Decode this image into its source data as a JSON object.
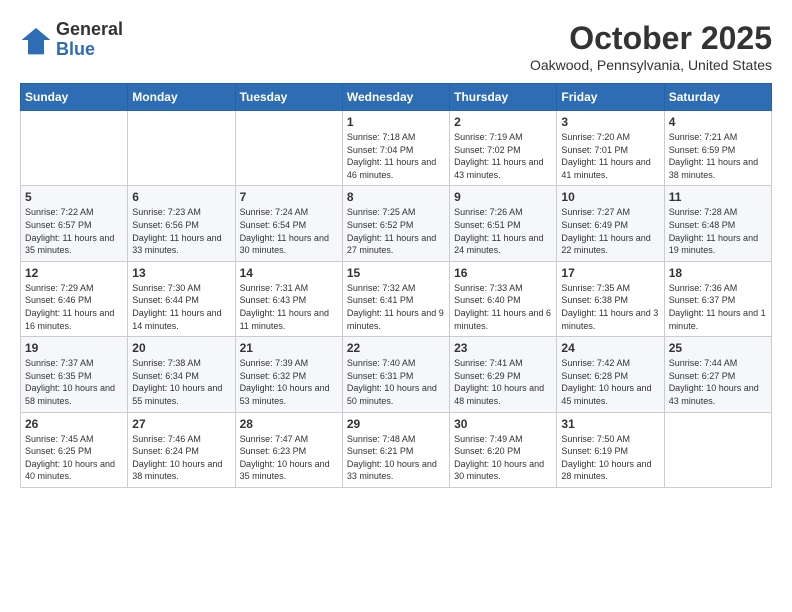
{
  "logo": {
    "general": "General",
    "blue": "Blue"
  },
  "title": "October 2025",
  "location": "Oakwood, Pennsylvania, United States",
  "days_of_week": [
    "Sunday",
    "Monday",
    "Tuesday",
    "Wednesday",
    "Thursday",
    "Friday",
    "Saturday"
  ],
  "weeks": [
    [
      {
        "day": "",
        "sunrise": "",
        "sunset": "",
        "daylight": ""
      },
      {
        "day": "",
        "sunrise": "",
        "sunset": "",
        "daylight": ""
      },
      {
        "day": "",
        "sunrise": "",
        "sunset": "",
        "daylight": ""
      },
      {
        "day": "1",
        "sunrise": "Sunrise: 7:18 AM",
        "sunset": "Sunset: 7:04 PM",
        "daylight": "Daylight: 11 hours and 46 minutes."
      },
      {
        "day": "2",
        "sunrise": "Sunrise: 7:19 AM",
        "sunset": "Sunset: 7:02 PM",
        "daylight": "Daylight: 11 hours and 43 minutes."
      },
      {
        "day": "3",
        "sunrise": "Sunrise: 7:20 AM",
        "sunset": "Sunset: 7:01 PM",
        "daylight": "Daylight: 11 hours and 41 minutes."
      },
      {
        "day": "4",
        "sunrise": "Sunrise: 7:21 AM",
        "sunset": "Sunset: 6:59 PM",
        "daylight": "Daylight: 11 hours and 38 minutes."
      }
    ],
    [
      {
        "day": "5",
        "sunrise": "Sunrise: 7:22 AM",
        "sunset": "Sunset: 6:57 PM",
        "daylight": "Daylight: 11 hours and 35 minutes."
      },
      {
        "day": "6",
        "sunrise": "Sunrise: 7:23 AM",
        "sunset": "Sunset: 6:56 PM",
        "daylight": "Daylight: 11 hours and 33 minutes."
      },
      {
        "day": "7",
        "sunrise": "Sunrise: 7:24 AM",
        "sunset": "Sunset: 6:54 PM",
        "daylight": "Daylight: 11 hours and 30 minutes."
      },
      {
        "day": "8",
        "sunrise": "Sunrise: 7:25 AM",
        "sunset": "Sunset: 6:52 PM",
        "daylight": "Daylight: 11 hours and 27 minutes."
      },
      {
        "day": "9",
        "sunrise": "Sunrise: 7:26 AM",
        "sunset": "Sunset: 6:51 PM",
        "daylight": "Daylight: 11 hours and 24 minutes."
      },
      {
        "day": "10",
        "sunrise": "Sunrise: 7:27 AM",
        "sunset": "Sunset: 6:49 PM",
        "daylight": "Daylight: 11 hours and 22 minutes."
      },
      {
        "day": "11",
        "sunrise": "Sunrise: 7:28 AM",
        "sunset": "Sunset: 6:48 PM",
        "daylight": "Daylight: 11 hours and 19 minutes."
      }
    ],
    [
      {
        "day": "12",
        "sunrise": "Sunrise: 7:29 AM",
        "sunset": "Sunset: 6:46 PM",
        "daylight": "Daylight: 11 hours and 16 minutes."
      },
      {
        "day": "13",
        "sunrise": "Sunrise: 7:30 AM",
        "sunset": "Sunset: 6:44 PM",
        "daylight": "Daylight: 11 hours and 14 minutes."
      },
      {
        "day": "14",
        "sunrise": "Sunrise: 7:31 AM",
        "sunset": "Sunset: 6:43 PM",
        "daylight": "Daylight: 11 hours and 11 minutes."
      },
      {
        "day": "15",
        "sunrise": "Sunrise: 7:32 AM",
        "sunset": "Sunset: 6:41 PM",
        "daylight": "Daylight: 11 hours and 9 minutes."
      },
      {
        "day": "16",
        "sunrise": "Sunrise: 7:33 AM",
        "sunset": "Sunset: 6:40 PM",
        "daylight": "Daylight: 11 hours and 6 minutes."
      },
      {
        "day": "17",
        "sunrise": "Sunrise: 7:35 AM",
        "sunset": "Sunset: 6:38 PM",
        "daylight": "Daylight: 11 hours and 3 minutes."
      },
      {
        "day": "18",
        "sunrise": "Sunrise: 7:36 AM",
        "sunset": "Sunset: 6:37 PM",
        "daylight": "Daylight: 11 hours and 1 minute."
      }
    ],
    [
      {
        "day": "19",
        "sunrise": "Sunrise: 7:37 AM",
        "sunset": "Sunset: 6:35 PM",
        "daylight": "Daylight: 10 hours and 58 minutes."
      },
      {
        "day": "20",
        "sunrise": "Sunrise: 7:38 AM",
        "sunset": "Sunset: 6:34 PM",
        "daylight": "Daylight: 10 hours and 55 minutes."
      },
      {
        "day": "21",
        "sunrise": "Sunrise: 7:39 AM",
        "sunset": "Sunset: 6:32 PM",
        "daylight": "Daylight: 10 hours and 53 minutes."
      },
      {
        "day": "22",
        "sunrise": "Sunrise: 7:40 AM",
        "sunset": "Sunset: 6:31 PM",
        "daylight": "Daylight: 10 hours and 50 minutes."
      },
      {
        "day": "23",
        "sunrise": "Sunrise: 7:41 AM",
        "sunset": "Sunset: 6:29 PM",
        "daylight": "Daylight: 10 hours and 48 minutes."
      },
      {
        "day": "24",
        "sunrise": "Sunrise: 7:42 AM",
        "sunset": "Sunset: 6:28 PM",
        "daylight": "Daylight: 10 hours and 45 minutes."
      },
      {
        "day": "25",
        "sunrise": "Sunrise: 7:44 AM",
        "sunset": "Sunset: 6:27 PM",
        "daylight": "Daylight: 10 hours and 43 minutes."
      }
    ],
    [
      {
        "day": "26",
        "sunrise": "Sunrise: 7:45 AM",
        "sunset": "Sunset: 6:25 PM",
        "daylight": "Daylight: 10 hours and 40 minutes."
      },
      {
        "day": "27",
        "sunrise": "Sunrise: 7:46 AM",
        "sunset": "Sunset: 6:24 PM",
        "daylight": "Daylight: 10 hours and 38 minutes."
      },
      {
        "day": "28",
        "sunrise": "Sunrise: 7:47 AM",
        "sunset": "Sunset: 6:23 PM",
        "daylight": "Daylight: 10 hours and 35 minutes."
      },
      {
        "day": "29",
        "sunrise": "Sunrise: 7:48 AM",
        "sunset": "Sunset: 6:21 PM",
        "daylight": "Daylight: 10 hours and 33 minutes."
      },
      {
        "day": "30",
        "sunrise": "Sunrise: 7:49 AM",
        "sunset": "Sunset: 6:20 PM",
        "daylight": "Daylight: 10 hours and 30 minutes."
      },
      {
        "day": "31",
        "sunrise": "Sunrise: 7:50 AM",
        "sunset": "Sunset: 6:19 PM",
        "daylight": "Daylight: 10 hours and 28 minutes."
      },
      {
        "day": "",
        "sunrise": "",
        "sunset": "",
        "daylight": ""
      }
    ]
  ]
}
